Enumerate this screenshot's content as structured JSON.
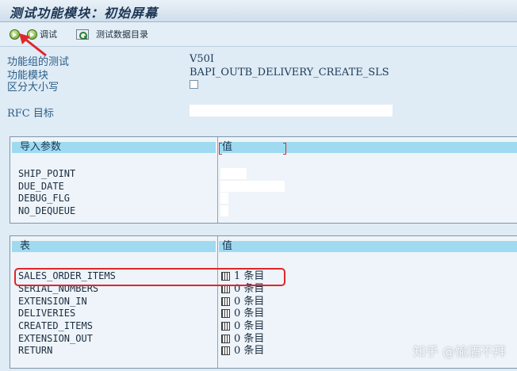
{
  "window": {
    "title": "测试功能模块：初始屏幕"
  },
  "toolbar": {
    "execute_icon": "execute-icon",
    "debug_label": "调试",
    "test_dir_label": "测试数据目录"
  },
  "header_fields": {
    "group_label": "功能组的测试",
    "group_value": "V50I",
    "module_label": "功能模块",
    "module_value": "BAPI_OUTB_DELIVERY_CREATE_SLS",
    "case_label": "区分大小写",
    "case_checked": false,
    "rfc_label": "RFC 目标",
    "rfc_value": ""
  },
  "import_params": {
    "header_name": "导入参数",
    "header_value": "值",
    "rows": [
      {
        "name": "SHIP_POINT",
        "value": ""
      },
      {
        "name": "DUE_DATE",
        "value": ""
      },
      {
        "name": "DEBUG_FLG",
        "value": ""
      },
      {
        "name": "NO_DEQUEUE",
        "value": ""
      }
    ]
  },
  "tables": {
    "header_name": "表",
    "header_value": "值",
    "rows": [
      {
        "name": "SALES_ORDER_ITEMS",
        "count": "1 条目"
      },
      {
        "name": "SERIAL_NUMBERS",
        "count": "0 条目"
      },
      {
        "name": "EXTENSION_IN",
        "count": "0 条目"
      },
      {
        "name": "DELIVERIES",
        "count": "0 条目"
      },
      {
        "name": "CREATED_ITEMS",
        "count": "0 条目"
      },
      {
        "name": "EXTENSION_OUT",
        "count": "0 条目"
      },
      {
        "name": "RETURN",
        "count": "0 条目"
      }
    ]
  },
  "watermark": "知乎 @愉酒不拜",
  "colors": {
    "background": "#dfebf5",
    "header_highlight": "#9fdaf0",
    "annotation_red": "#e0262a",
    "label_blue": "#2a5d88"
  }
}
